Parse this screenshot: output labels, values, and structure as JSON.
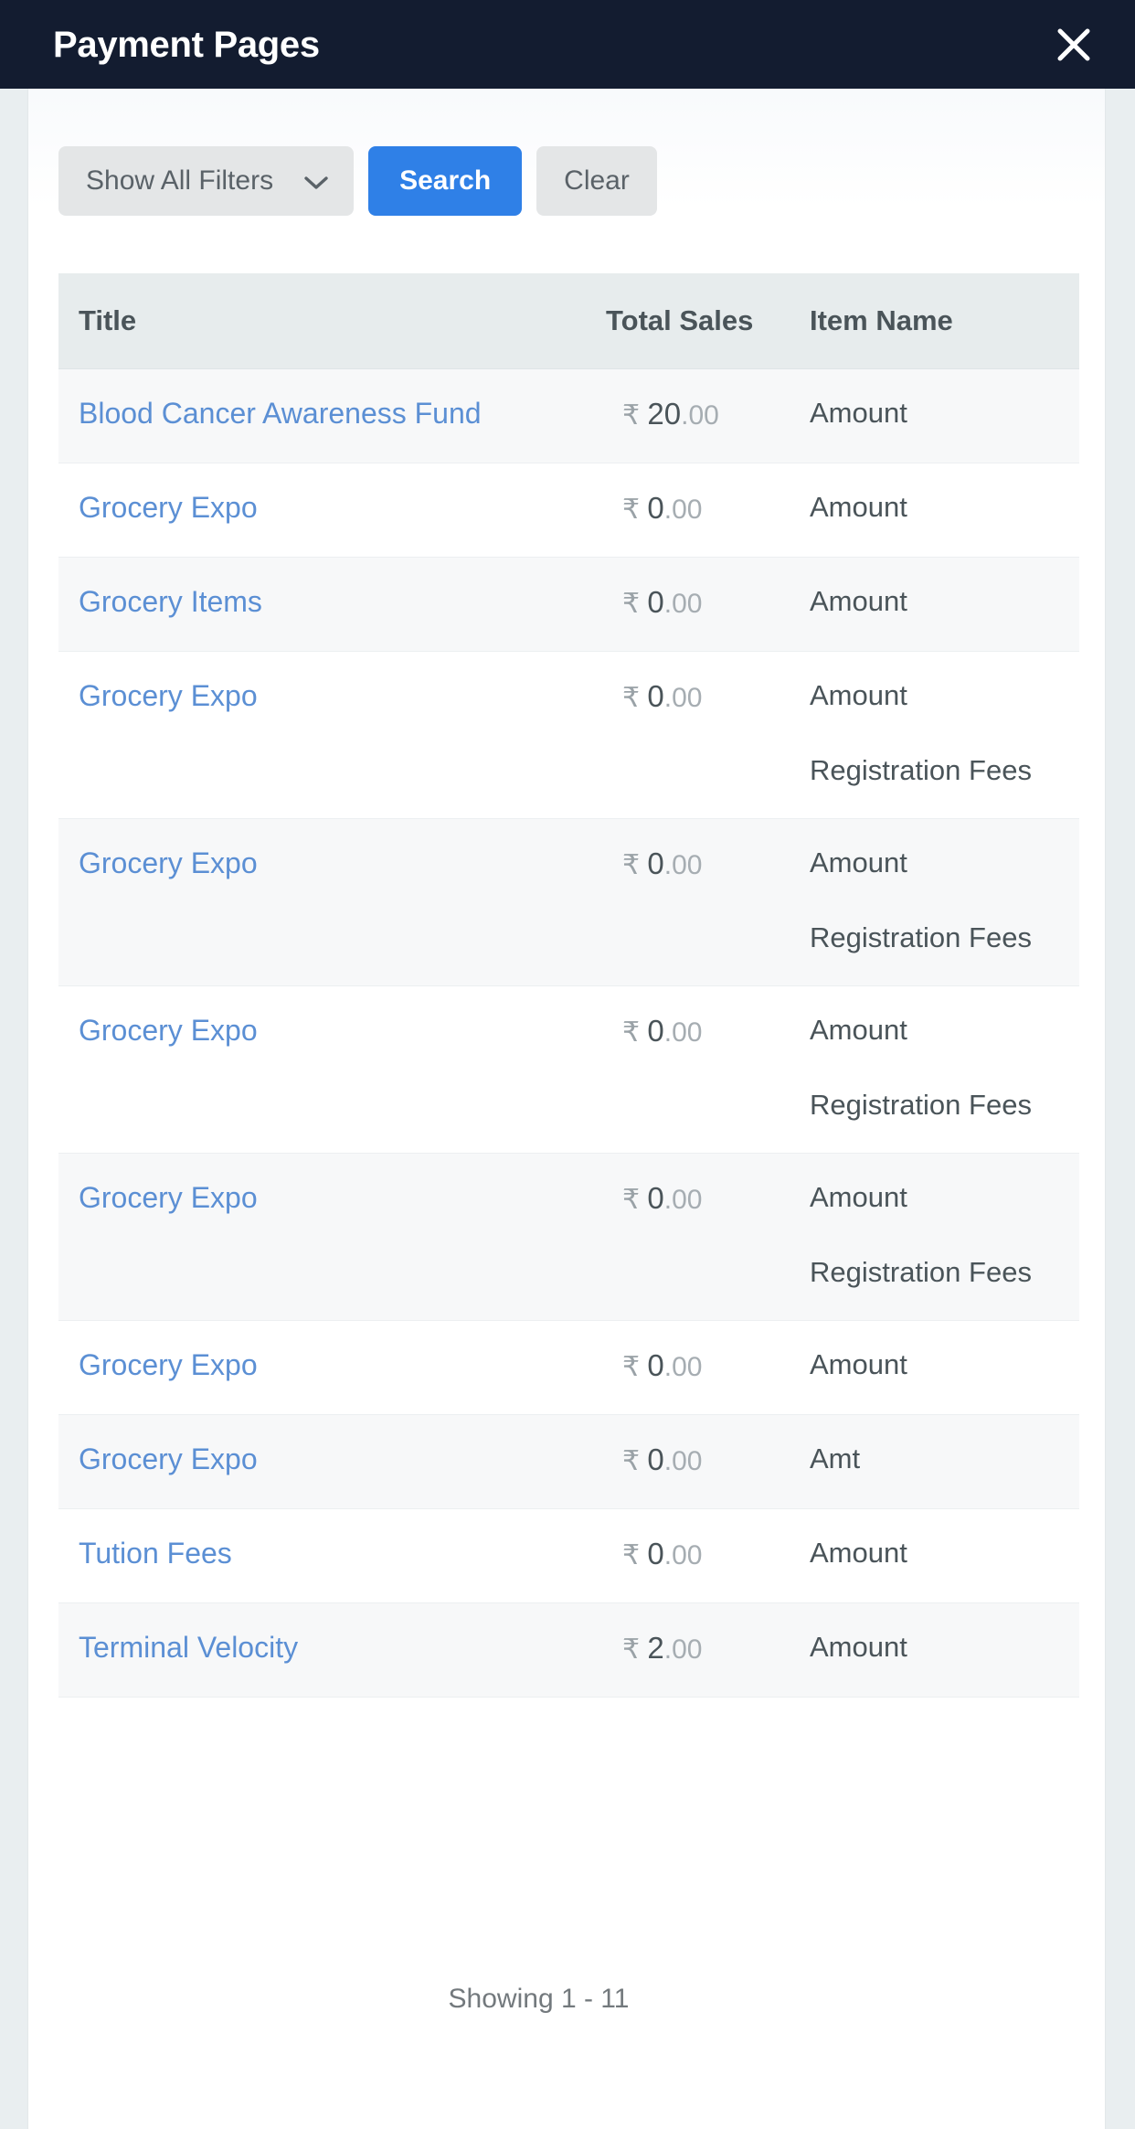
{
  "titlebar": {
    "title": "Payment Pages",
    "close_icon": "close-icon"
  },
  "toolbar": {
    "filters_label": "Show All Filters",
    "filters_chevron_icon": "chevron-down-icon",
    "search_label": "Search",
    "clear_label": "Clear"
  },
  "colors": {
    "titlebar_bg": "#131c30",
    "search_button": "#2f80e7",
    "link": "#5b8fd4",
    "table_header_bg": "#e7eced",
    "page_bg": "#e9eef0"
  },
  "table": {
    "columns": [
      "Title",
      "Total Sales",
      "Item Name",
      ""
    ],
    "currency_symbol": "₹",
    "rows": [
      {
        "title": "Blood Cancer Awareness Fund",
        "sales_int": "20",
        "sales_dec": ".00",
        "items": [
          "Amount"
        ]
      },
      {
        "title": "Grocery Expo",
        "sales_int": "0",
        "sales_dec": ".00",
        "items": [
          "Amount"
        ]
      },
      {
        "title": "Grocery Items",
        "sales_int": "0",
        "sales_dec": ".00",
        "items": [
          "Amount"
        ]
      },
      {
        "title": "Grocery Expo",
        "sales_int": "0",
        "sales_dec": ".00",
        "items": [
          "Amount",
          "Registration Fees"
        ]
      },
      {
        "title": "Grocery Expo",
        "sales_int": "0",
        "sales_dec": ".00",
        "items": [
          "Amount",
          "Registration Fees"
        ]
      },
      {
        "title": "Grocery Expo",
        "sales_int": "0",
        "sales_dec": ".00",
        "items": [
          "Amount",
          "Registration Fees"
        ]
      },
      {
        "title": "Grocery Expo",
        "sales_int": "0",
        "sales_dec": ".00",
        "items": [
          "Amount",
          "Registration Fees"
        ]
      },
      {
        "title": "Grocery Expo",
        "sales_int": "0",
        "sales_dec": ".00",
        "items": [
          "Amount"
        ]
      },
      {
        "title": "Grocery Expo",
        "sales_int": "0",
        "sales_dec": ".00",
        "items": [
          "Amt"
        ]
      },
      {
        "title": "Tution Fees",
        "sales_int": "0",
        "sales_dec": ".00",
        "items": [
          "Amount"
        ]
      },
      {
        "title": "Terminal Velocity",
        "sales_int": "2",
        "sales_dec": ".00",
        "items": [
          "Amount"
        ]
      }
    ]
  },
  "footer": {
    "showing": "Showing 1 - 11"
  }
}
